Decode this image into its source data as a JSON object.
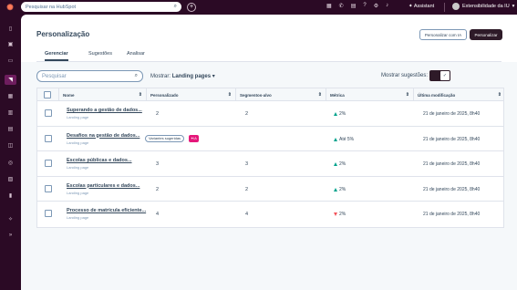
{
  "topbar": {
    "search_placeholder": "Pesquisar na HubSpot",
    "assistant_label": "Assistant",
    "account_name": "Extensibilidade da IU"
  },
  "page": {
    "title": "Personalização",
    "btn_personalize_ai": "Personalizar com IA",
    "btn_personalize": "Personalizar"
  },
  "tabs": [
    {
      "label": "Gerenciar",
      "active": true
    },
    {
      "label": "Sugestões",
      "active": false
    },
    {
      "label": "Analisar",
      "active": false
    }
  ],
  "filters": {
    "search_placeholder": "Pesquisar",
    "show_label": "Mostrar:",
    "show_value": "Landing pages",
    "suggestions_label": "Mostrar sugestões:",
    "suggestions_on": true
  },
  "table": {
    "columns": [
      "Nome",
      "Personalizado",
      "Segmentos-alvo",
      "Métrica",
      "Última modificação"
    ],
    "rows": [
      {
        "name": "Superando a gestão de dados...",
        "type": "Landing page",
        "personalized": "2",
        "segments": "2",
        "metric": "2%",
        "trend": "up",
        "modified": "21 de janeiro de 2025, 8h40"
      },
      {
        "name": "Desafios na gestão de dados...",
        "type": "Landing page",
        "suggestion_pill": "Variantes sugeridas",
        "suggestion_badge": "IA",
        "personalized": "",
        "segments": "",
        "metric": "Até 5%",
        "trend": "up",
        "modified": "21 de janeiro de 2025, 8h40"
      },
      {
        "name": "Escolas públicas e dados...",
        "type": "Landing page",
        "personalized": "3",
        "segments": "3",
        "metric": "2%",
        "trend": "up",
        "modified": "21 de janeiro de 2025, 8h40"
      },
      {
        "name": "Escolas particulares e dados...",
        "type": "Landing page",
        "personalized": "2",
        "segments": "2",
        "metric": "2%",
        "trend": "up",
        "modified": "21 de janeiro de 2025, 8h40"
      },
      {
        "name": "Processo de matrícula eficiente...",
        "type": "Landing page",
        "personalized": "4",
        "segments": "4",
        "metric": "2%",
        "trend": "down",
        "modified": "21 de janeiro de 2025, 8h40"
      }
    ]
  },
  "icons": {
    "logo": "hubspot-sprocket-icon",
    "top": [
      "grid-icon",
      "phone-icon",
      "marketplace-icon",
      "help-icon",
      "settings-icon",
      "bell-icon"
    ],
    "sidebar": [
      "bookmark-icon",
      "contacts-icon",
      "inbox-icon",
      "marketing-icon",
      "content-icon",
      "sales-icon",
      "commerce-icon",
      "service-icon",
      "data-icon",
      "library-icon",
      "reports-icon",
      "automation-icon",
      "collapse-icon"
    ]
  },
  "colors": {
    "accent": "#2e1a28",
    "brand": "#ff7a59",
    "trend_up": "#00a38d",
    "trend_down": "#f2545b",
    "badge": "#e5177a"
  }
}
